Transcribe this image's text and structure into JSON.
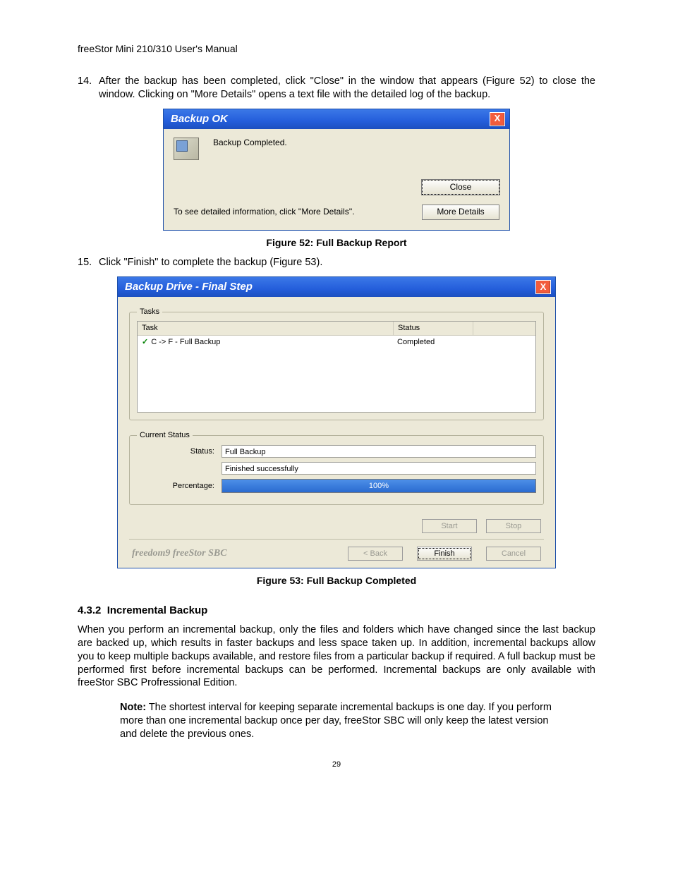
{
  "header": "freeStor Mini 210/310 User's Manual",
  "step14": {
    "num": "14.",
    "text": "After the backup has been completed, click \"Close\" in the window that appears (Figure 52) to close the window.  Clicking on \"More Details\" opens a text file with the detailed log of the backup."
  },
  "dialog1": {
    "title": "Backup OK",
    "message": "Backup Completed.",
    "hint": "To see detailed information, click ''More Details''.",
    "close_btn": "Close",
    "more_btn": "More Details"
  },
  "caption52": "Figure 52: Full Backup Report",
  "step15": {
    "num": "15.",
    "text": "Click \"Finish\" to complete the backup (Figure 53)."
  },
  "dialog2": {
    "title": "Backup Drive - Final Step",
    "tasks_legend": "Tasks",
    "col_task": "Task",
    "col_status": "Status",
    "row_task": "C -> F - Full Backup",
    "row_status": "Completed",
    "cs_legend": "Current Status",
    "lbl_status": "Status:",
    "val_status1": "Full Backup",
    "val_status2": "Finished successfully",
    "lbl_percent": "Percentage:",
    "val_percent": "100%",
    "btn_start": "Start",
    "btn_stop": "Stop",
    "brand": "freedom9 freeStor SBC",
    "btn_back": "< Back",
    "btn_finish": "Finish",
    "btn_cancel": "Cancel"
  },
  "caption53": "Figure 53: Full Backup Completed",
  "section": {
    "num": "4.3.2",
    "title": "Incremental Backup"
  },
  "para": "When you perform an incremental backup, only the files and folders which have changed since the last backup are backed up, which results in faster backups and less space taken up.  In addition, incremental backups allow you to keep multiple backups available, and restore files from a particular backup if required.  A full backup must be performed first before incremental backups can be performed.    Incremental backups are only available with freeStor SBC Profressional Edition.",
  "note_label": "Note:",
  "note_text": " The shortest interval for keeping separate incremental backups is one day. If you perform more than one incremental backup once per day, freeStor SBC will only keep the latest version and delete the previous ones.",
  "page_number": "29"
}
